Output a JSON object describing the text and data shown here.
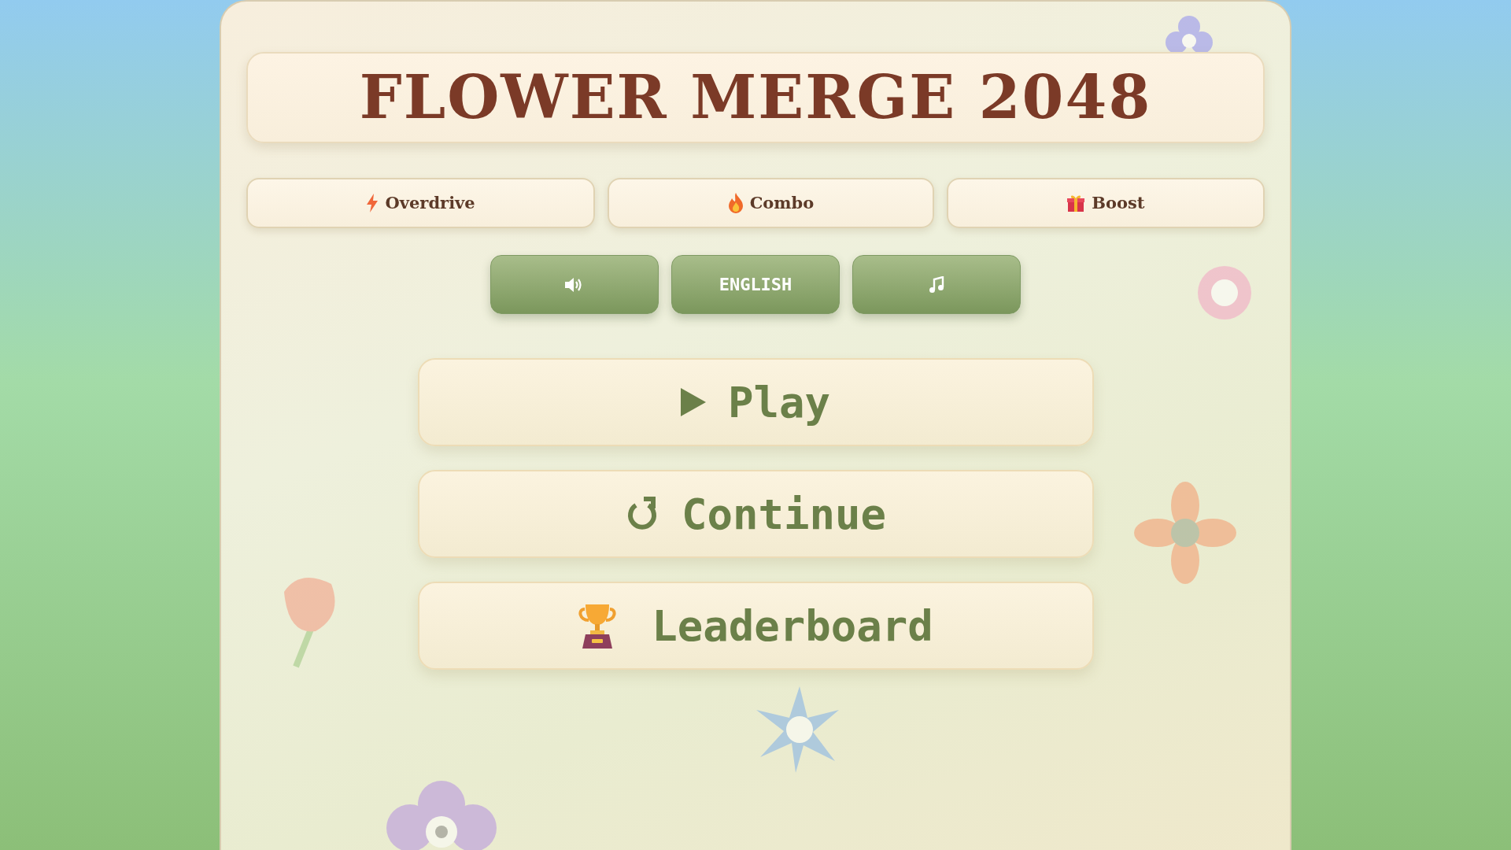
{
  "title": "FLOWER MERGE 2048",
  "powerups": [
    {
      "kind": "bolt",
      "label": "Overdrive"
    },
    {
      "kind": "flame",
      "label": "Combo"
    },
    {
      "kind": "gift",
      "label": "Boost"
    }
  ],
  "settings": [
    {
      "kind": "sound"
    },
    {
      "kind": "language",
      "label": "ENGLISH"
    },
    {
      "kind": "music"
    }
  ],
  "menu": [
    {
      "kind": "play",
      "label": "Play"
    },
    {
      "kind": "continue",
      "label": "Continue"
    },
    {
      "kind": "leaderboard",
      "label": "Leaderboard"
    }
  ]
}
